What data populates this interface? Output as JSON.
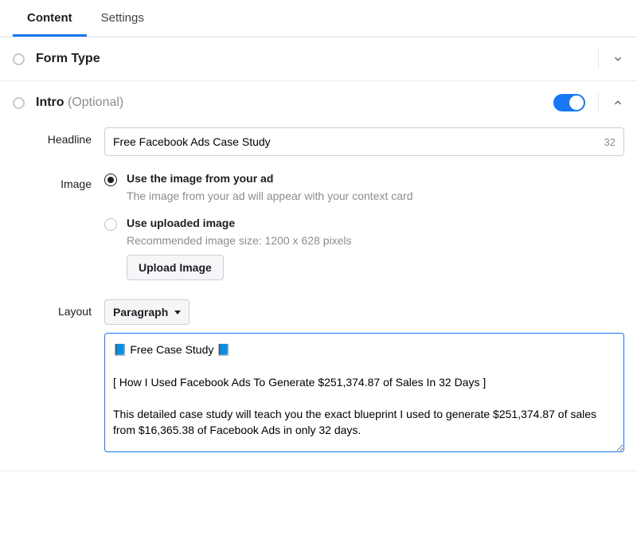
{
  "tabs": {
    "content": "Content",
    "settings": "Settings"
  },
  "sections": {
    "form_type": {
      "title": "Form Type"
    },
    "intro": {
      "title": "Intro",
      "optional": " (Optional)",
      "toggle_on": true
    }
  },
  "intro": {
    "headline_label": "Headline",
    "headline_value": "Free Facebook Ads Case Study",
    "headline_count": "32",
    "image_label": "Image",
    "image_option1_label": "Use the image from your ad",
    "image_option1_sub": "The image from your ad will appear with your context card",
    "image_option2_label": "Use uploaded image",
    "image_option2_sub": "Recommended image size: 1200 x 628 pixels",
    "upload_button": "Upload Image",
    "layout_label": "Layout",
    "layout_value": "Paragraph",
    "paragraph_text": "📘 Free Case Study 📘\n\n[ How I Used Facebook Ads To Generate $251,374.87 of Sales In 32 Days ]\n\nThis detailed case study will teach you the exact blueprint I used to generate $251,374.87 of sales from $16,365.38 of Facebook Ads in only 32 days."
  }
}
